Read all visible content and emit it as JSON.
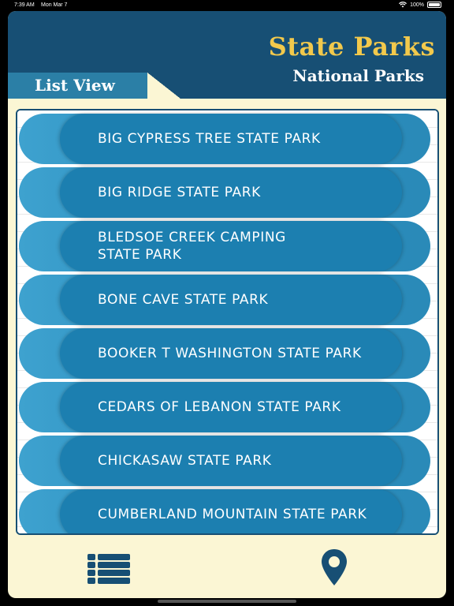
{
  "status_bar": {
    "time": "7:39 AM",
    "date": "Mon Mar 7",
    "battery": "100%"
  },
  "header": {
    "title": "State Parks",
    "subtitle": "National Parks",
    "tab_label": "List View"
  },
  "colors": {
    "header_bg": "#174f74",
    "title_gold": "#f2c94c",
    "tab_blue": "#2b7fa6",
    "page_bg": "#fbf6d4",
    "item_blue": "#1c7fb0"
  },
  "parks": [
    {
      "name": "BIG CYPRESS TREE STATE PARK"
    },
    {
      "name": "BIG RIDGE STATE PARK"
    },
    {
      "name": "BLEDSOE CREEK CAMPING STATE PARK"
    },
    {
      "name": "BONE CAVE STATE PARK"
    },
    {
      "name": "BOOKER T WASHINGTON STATE PARK"
    },
    {
      "name": "CEDARS OF LEBANON STATE PARK"
    },
    {
      "name": "CHICKASAW STATE PARK"
    },
    {
      "name": "CUMBERLAND MOUNTAIN STATE PARK"
    }
  ],
  "bottom_bar": {
    "left_icon": "list-icon",
    "right_icon": "map-pin-icon"
  }
}
